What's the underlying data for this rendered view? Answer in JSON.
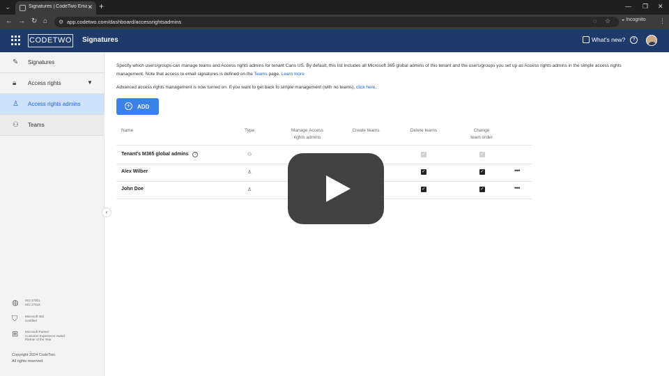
{
  "browser": {
    "tab_title": "Signatures | CodeTwo Email Signatures",
    "url": "app.codetwo.com/dashboard/accessrightsadmins",
    "incognito_label": "Incognito"
  },
  "header": {
    "logo": "CODETWO",
    "app_name": "Signatures",
    "whats_new": "What's new?"
  },
  "sidebar": {
    "items": [
      {
        "label": "Signatures",
        "icon": "signature-icon"
      },
      {
        "label": "Access rights",
        "icon": "lock-icon"
      },
      {
        "label": "Access rights admins",
        "icon": "person-icon"
      },
      {
        "label": "Teams",
        "icon": "team-icon"
      }
    ],
    "certs": [
      {
        "icon": "iso-globe-icon",
        "line1": "ISO 27001",
        "line2": "ISO 27018"
      },
      {
        "icon": "shield-check-icon",
        "line1": "Microsoft 365",
        "line2": "Certified"
      },
      {
        "icon": "microsoft-logo-icon",
        "line1": "Microsoft Partner",
        "line2": "Customer Experience Award",
        "line3": "Partner of the Year"
      }
    ],
    "copyright": "Copyright 2024 CodeTwo.",
    "rights": "All rights reserved."
  },
  "main": {
    "intro_1": "Specify which users/groups can manage teams and Access rights admins for tenant Cans US. By default, this list includes all Microsoft 365 global admins of this tenant and the users/groups you set up as Access rights admins in the simple access rights",
    "intro_2a": "management. Note that access to email signatures is defined on the ",
    "intro_2_link": "Teams",
    "intro_2b": " page. ",
    "intro_2_learn": "Learn more",
    "advanced": "Advanced access rights management is now turned on. If you want to get back to simple management (with no teams), ",
    "advanced_link": "click here",
    "advanced_end": ".",
    "add_label": "ADD"
  },
  "table": {
    "headers": {
      "name": "Name",
      "type": "Type",
      "manage_1": "Manage Access",
      "manage_2": "rights admins",
      "create": "Create teams",
      "delete": "Delete teams",
      "change_1": "Change",
      "change_2": "team order"
    },
    "rows": [
      {
        "name": "Tenant's M365 global admins",
        "type_icon": "group-icon",
        "delete_teams": "checked-disabled",
        "change_team_order": "checked-disabled"
      },
      {
        "name": "Alex Wilber",
        "type_icon": "user-icon",
        "delete_teams": "checked",
        "change_team_order": "checked"
      },
      {
        "name": "John Doe",
        "type_icon": "user-icon",
        "delete_teams": "checked",
        "change_team_order": "checked"
      }
    ]
  }
}
